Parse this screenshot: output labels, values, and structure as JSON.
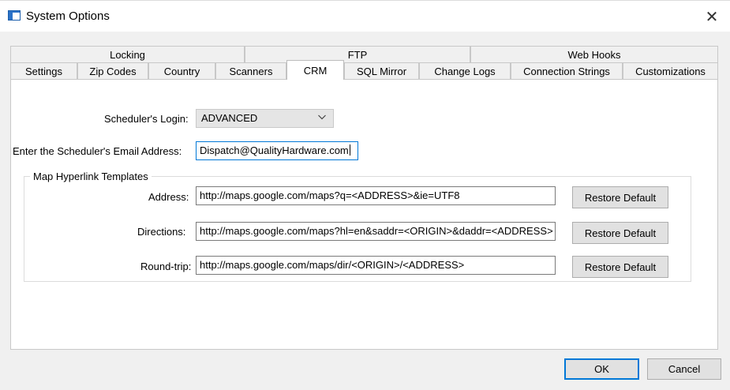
{
  "window": {
    "title": "System Options",
    "close_glyph": "✕"
  },
  "tabs": {
    "row1": [
      "Locking",
      "FTP",
      "Web Hooks"
    ],
    "row2": [
      "Settings",
      "Zip Codes",
      "Country",
      "Scanners",
      "CRM",
      "SQL Mirror",
      "Change Logs",
      "Connection Strings",
      "Customizations"
    ],
    "selected": "CRM"
  },
  "crm": {
    "scheduler_login_label": "Scheduler's Login:",
    "scheduler_login_value": "ADVANCED",
    "email_label": "Enter the Scheduler's Email Address:",
    "email_value": "Dispatch@QualityHardware.com",
    "map_group_title": "Map Hyperlink Templates",
    "address_label": "Address:",
    "address_value": "http://maps.google.com/maps?q=<ADDRESS>&ie=UTF8",
    "directions_label": "Directions:",
    "directions_value": "http://maps.google.com/maps?hl=en&saddr=<ORIGIN>&daddr=<ADDRESS>",
    "roundtrip_label": "Round-trip:",
    "roundtrip_value": "http://maps.google.com/maps/dir/<ORIGIN>/<ADDRESS>",
    "restore_default_label": "Restore Default"
  },
  "footer": {
    "ok_label": "OK",
    "cancel_label": "Cancel"
  },
  "colors": {
    "accent": "#0078d7",
    "window_bg": "#f0f0f0",
    "panel_bg": "#ffffff"
  },
  "icons": [
    "app-window-icon",
    "close-icon",
    "chevron-down-icon"
  ]
}
